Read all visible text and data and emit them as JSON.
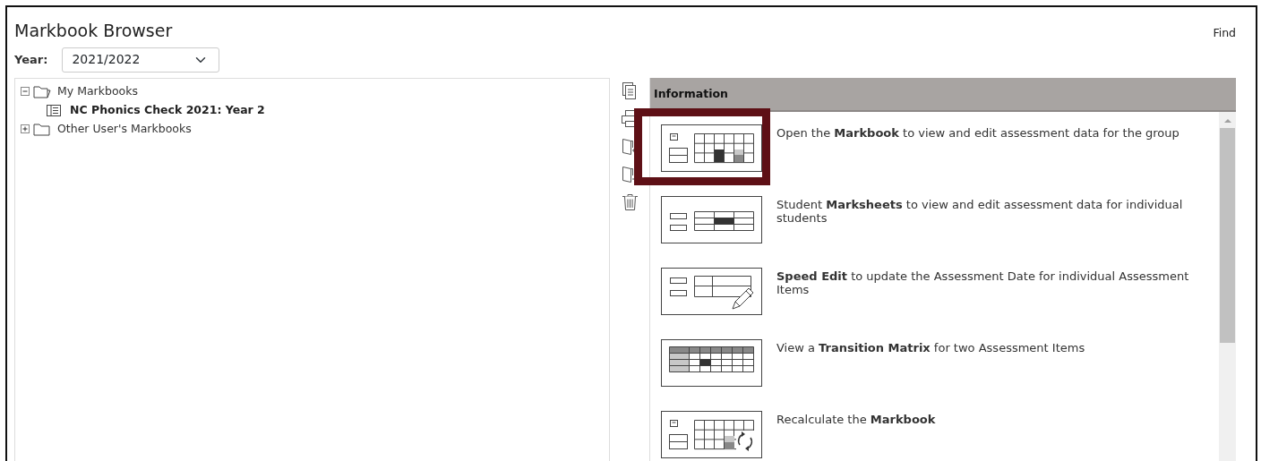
{
  "title": "Markbook Browser",
  "find_link": "Find",
  "year": {
    "label": "Year:",
    "value": "2021/2022"
  },
  "tree": [
    {
      "kind": "folder",
      "label": "My Markbooks",
      "expanded": true,
      "children": [
        {
          "kind": "markbook",
          "label": "NC Phonics Check 2021: Year 2"
        }
      ]
    },
    {
      "kind": "folder",
      "label": "Other User's Markbooks",
      "expanded": false
    }
  ],
  "info": {
    "header": "Information",
    "items": [
      {
        "kind": "markbook",
        "highlighted": true,
        "text": "Open the **Markbook** to view and edit assessment data for the group"
      },
      {
        "kind": "marksheet",
        "highlighted": false,
        "text": "Student **Marksheets** to view and edit assessment data for individual students"
      },
      {
        "kind": "speed-edit",
        "highlighted": false,
        "text": "**Speed Edit** to update the Assessment Date for individual Assessment Items"
      },
      {
        "kind": "transition",
        "highlighted": false,
        "text": "View a **Transition Matrix** for two Assessment Items"
      },
      {
        "kind": "recalculate",
        "highlighted": false,
        "text": "Recalculate the **Markbook**"
      }
    ]
  }
}
